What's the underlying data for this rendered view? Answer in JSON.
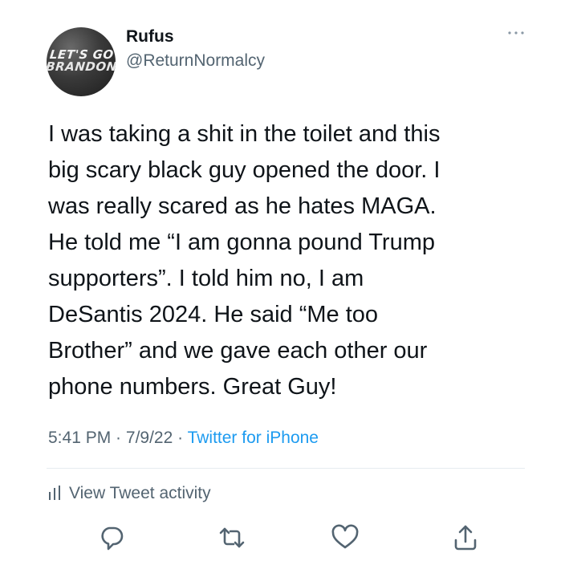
{
  "user": {
    "avatar_text_line1": "LET'S GO",
    "avatar_text_line2": "BRANDON",
    "name": "Rufus",
    "handle": "@ReturnNormalcy"
  },
  "tweet": {
    "lines": [
      "I was taking a shit in the toilet and this",
      "big scary black guy opened the door. I",
      "was really scared as he hates MAGA.",
      "He told me “I am gonna pound Trump",
      "supporters”. I told him no, I am",
      "DeSantis 2024. He said “Me too",
      "Brother” and we gave each other our",
      "phone numbers. Great Guy!"
    ],
    "time": "5:41 PM",
    "date": "7/9/22",
    "separator": " · ",
    "source": "Twitter for iPhone"
  },
  "activity_label": "View Tweet activity",
  "colors": {
    "text": "#0f1419",
    "secondary": "#536471",
    "link": "#1d9bf0",
    "divider": "#e6ecf0"
  },
  "icons": [
    "more-icon",
    "activity-icon",
    "reply-icon",
    "retweet-icon",
    "like-icon",
    "share-icon"
  ]
}
